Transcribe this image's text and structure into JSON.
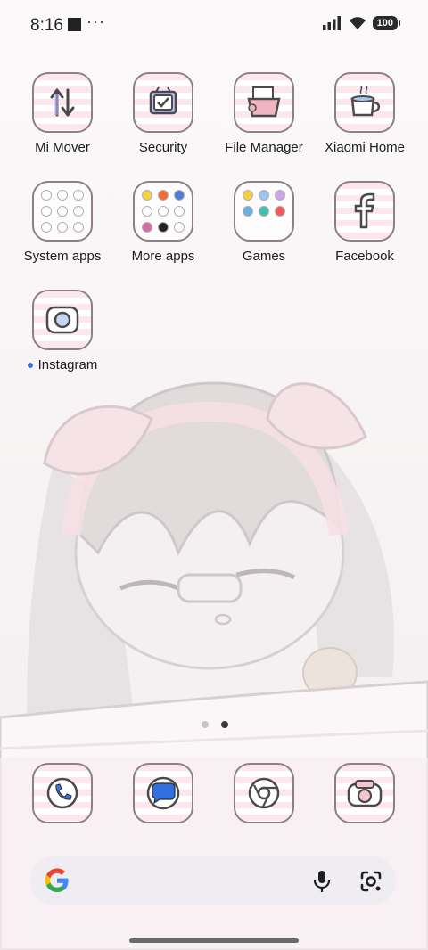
{
  "status_bar": {
    "time": "8:16",
    "overflow": "···",
    "battery": "100"
  },
  "apps": [
    {
      "label": "Mi Mover"
    },
    {
      "label": "Security"
    },
    {
      "label": "File Manager"
    },
    {
      "label": "Xiaomi Home"
    },
    {
      "label": "System apps"
    },
    {
      "label": "More apps"
    },
    {
      "label": "Games"
    },
    {
      "label": "Facebook"
    },
    {
      "label": "Instagram",
      "badge": "new"
    }
  ],
  "dock": [
    {
      "icon": "phone-icon"
    },
    {
      "icon": "messages-icon"
    },
    {
      "icon": "chrome-icon"
    },
    {
      "icon": "camera-icon"
    }
  ],
  "pager": {
    "pages": 2,
    "active": 2
  },
  "colors": {
    "accent": "#3a78e0",
    "stripe": "#fde6ee",
    "outline": "#8d7f82"
  }
}
